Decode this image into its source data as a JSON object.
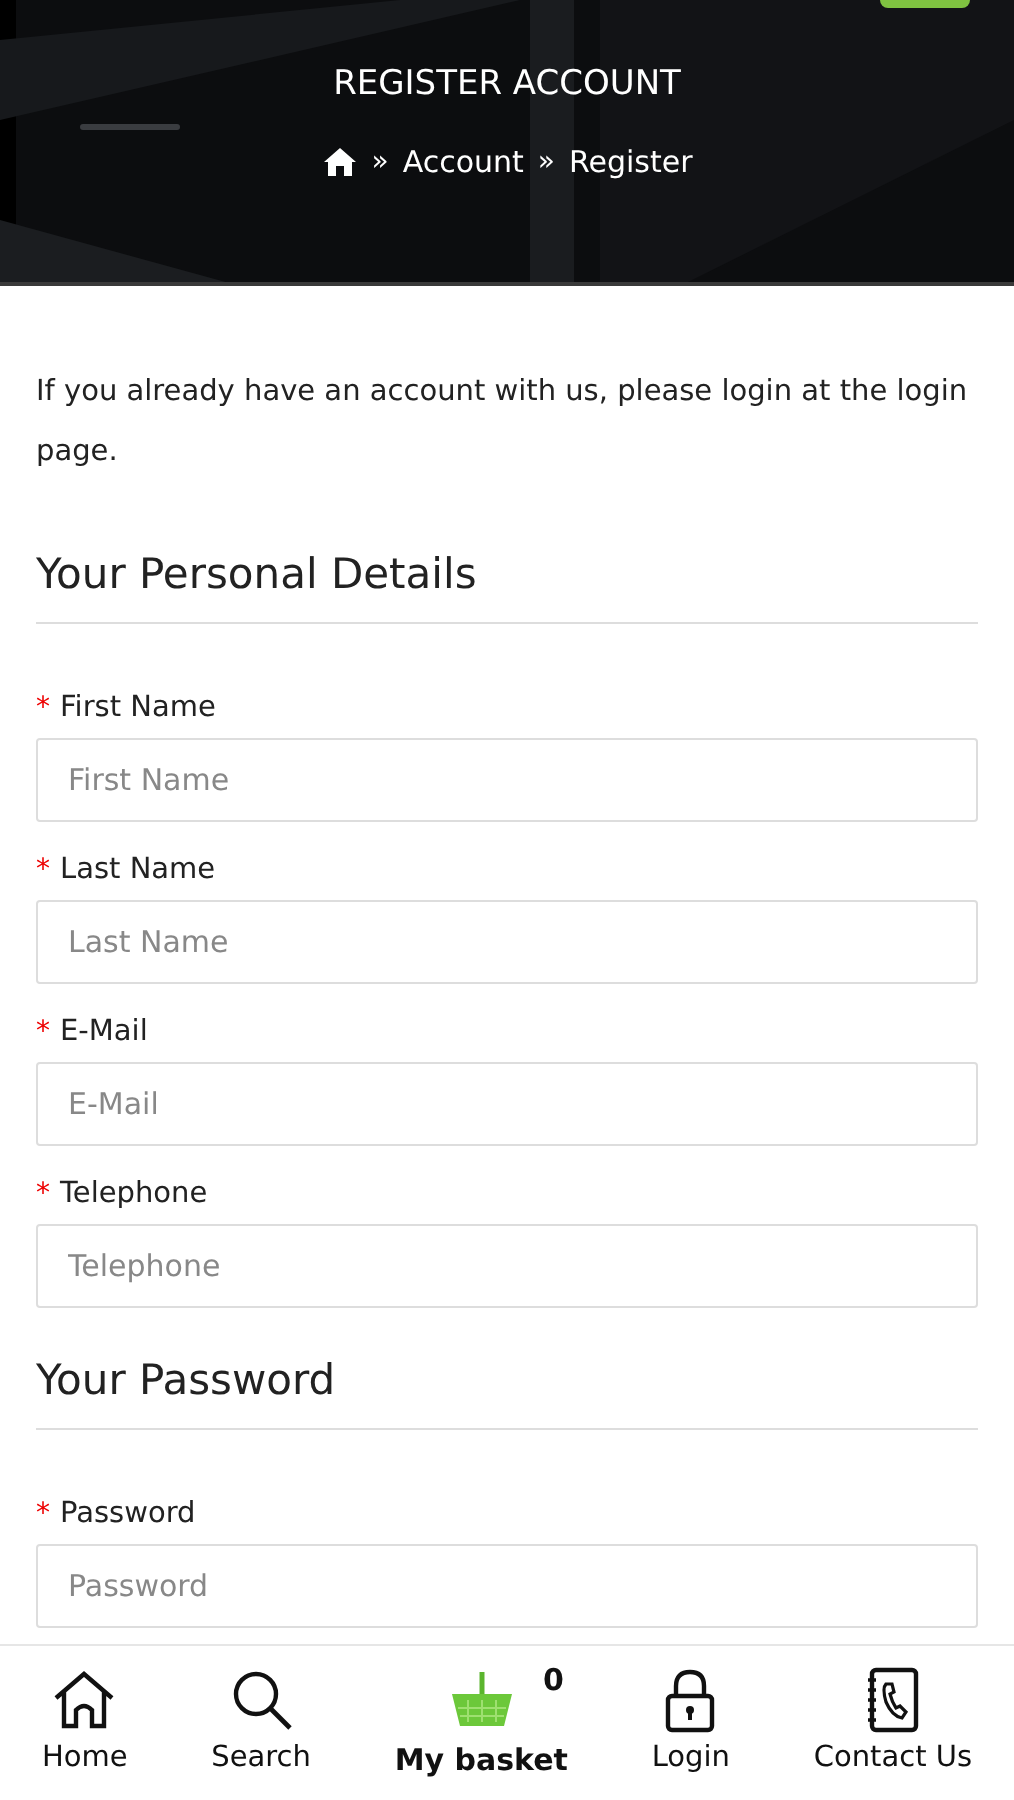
{
  "header": {
    "title": "REGISTER ACCOUNT",
    "breadcrumb": [
      {
        "separator": "»",
        "label": "Account"
      },
      {
        "separator": "»",
        "label": "Register"
      }
    ]
  },
  "intro": "If you already have an account with us, please login at the login page.",
  "sections": [
    {
      "heading": "Your Personal Details",
      "fields": [
        {
          "marker": "*",
          "label": "First Name",
          "placeholder": "First Name"
        },
        {
          "marker": "*",
          "label": "Last Name",
          "placeholder": "Last Name"
        },
        {
          "marker": "*",
          "label": "E-Mail",
          "placeholder": "E-Mail"
        },
        {
          "marker": "*",
          "label": "Telephone",
          "placeholder": "Telephone"
        }
      ]
    },
    {
      "heading": "Your Password",
      "fields": [
        {
          "marker": "*",
          "label": "Password",
          "placeholder": "Password"
        }
      ]
    }
  ],
  "bottom_nav": [
    {
      "kind": "home",
      "label": "Home"
    },
    {
      "kind": "search",
      "label": "Search"
    },
    {
      "kind": "basket",
      "label": "My basket",
      "count": "0"
    },
    {
      "kind": "login",
      "label": "Login"
    },
    {
      "kind": "contact",
      "label": "Contact Us"
    }
  ]
}
